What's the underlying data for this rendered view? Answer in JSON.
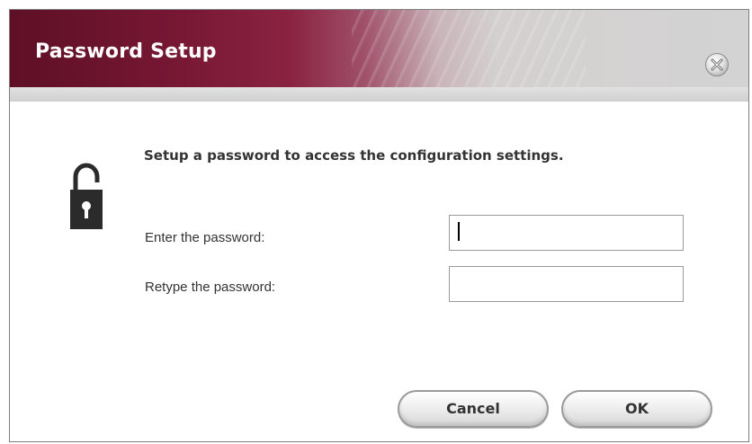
{
  "dialog": {
    "title": "Password Setup",
    "close_icon": "close-x-icon",
    "lock_icon": "unlocked-padlock-icon",
    "instruction": "Setup a password to access the configuration settings.",
    "fields": [
      {
        "label": "Enter the password:",
        "value": "",
        "placeholder": ""
      },
      {
        "label": "Retype the password:",
        "value": "",
        "placeholder": ""
      }
    ],
    "buttons": {
      "cancel_label": "Cancel",
      "ok_label": "OK"
    }
  },
  "colors": {
    "title_bar_maroon": "#761734",
    "title_bar_gray": "#d3d3d3",
    "text": "#333333"
  }
}
